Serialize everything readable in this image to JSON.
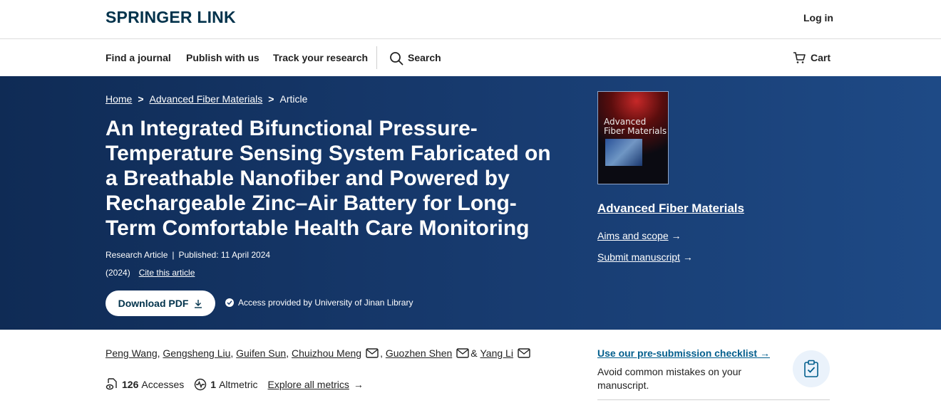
{
  "header": {
    "logo": "SPRINGER LINK",
    "login": "Log in"
  },
  "nav": {
    "find_journal": "Find a journal",
    "publish": "Publish with us",
    "track": "Track your research",
    "search": "Search",
    "cart": "Cart"
  },
  "breadcrumb": {
    "home": "Home",
    "journal": "Advanced Fiber Materials",
    "current": "Article",
    "separator": ">"
  },
  "article": {
    "title": "An Integrated Bifunctional Pressure-Temperature Sensing System Fabricated on a Breathable Nanofiber and Powered by Rechargeable Zinc–Air Battery for Long-Term Comfortable Health Care Monitoring",
    "type": "Research Article",
    "published": "Published: 11 April 2024",
    "year": "(2024)",
    "cite": "Cite this article",
    "download": "Download PDF",
    "access": "Access provided by University of Jinan Library"
  },
  "journal": {
    "cover_title_1": "Advanced",
    "cover_title_2": "Fiber Materials",
    "name": "Advanced Fiber Materials",
    "aims": "Aims and scope",
    "submit": "Submit manuscript",
    "arrow": "→"
  },
  "authors": [
    {
      "name": "Peng Wang",
      "email": false
    },
    {
      "name": "Gengsheng Liu",
      "email": false
    },
    {
      "name": "Guifen Sun",
      "email": false
    },
    {
      "name": "Chuizhou Meng",
      "email": true
    },
    {
      "name": "Guozhen Shen",
      "email": true
    },
    {
      "name": "Yang Li",
      "email": true
    }
  ],
  "author_separator_comma": ",",
  "author_separator_and": "&",
  "metrics": {
    "accesses_count": "126",
    "accesses_label": "Accesses",
    "altmetric_count": "1",
    "altmetric_label": "Altmetric",
    "explore": "Explore all metrics",
    "arrow": "→"
  },
  "checklist": {
    "link": "Use our pre-submission checklist",
    "arrow": "→",
    "text": "Avoid common mistakes on your manuscript."
  },
  "colors": {
    "brand": "#01324b",
    "hero_start": "#0f2b55",
    "hero_end": "#1e4a86",
    "link_blue": "#025e8d"
  }
}
